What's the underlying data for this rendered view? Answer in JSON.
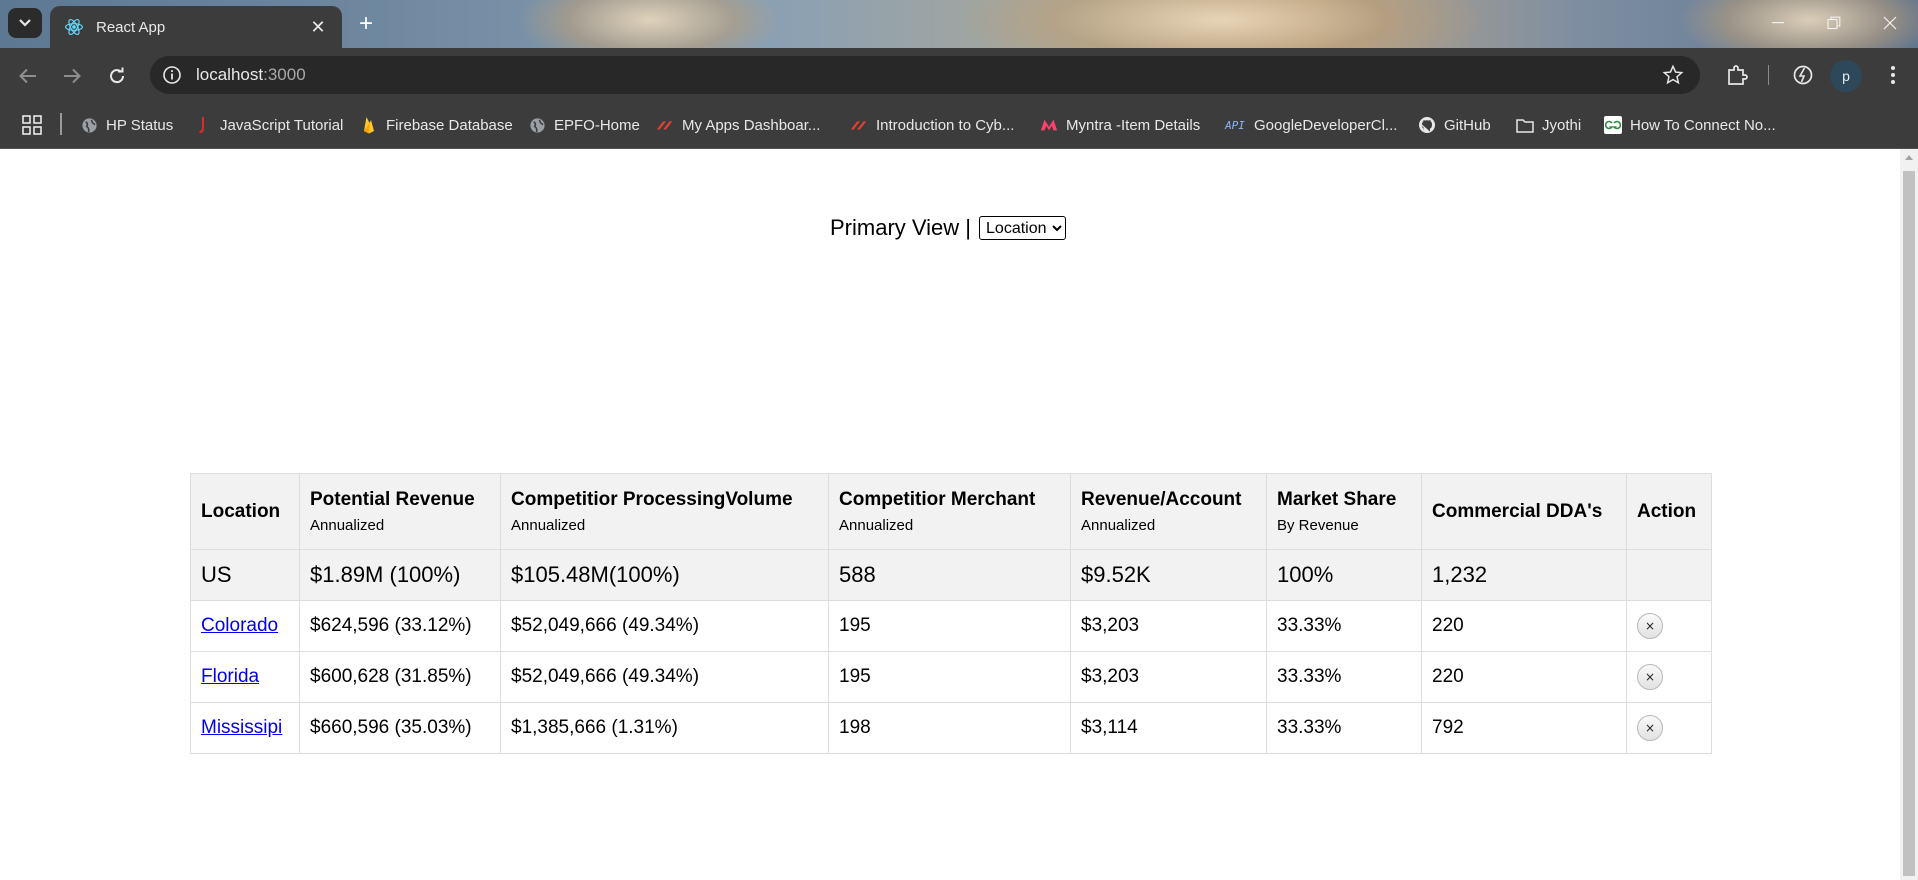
{
  "browser": {
    "tab_title": "React App",
    "url_host": "localhost",
    "url_port": ":3000",
    "profile_initial": "p",
    "bookmarks": [
      {
        "label": "HP Status",
        "icon": "globe-icon"
      },
      {
        "label": "JavaScript Tutorial",
        "icon": "javascript-tutorial-icon"
      },
      {
        "label": "Firebase Database",
        "icon": "firebase-icon"
      },
      {
        "label": "EPFO-Home",
        "icon": "globe-icon"
      },
      {
        "label": "My Apps Dashboar...",
        "icon": "zscaler-icon"
      },
      {
        "label": "Introduction to Cyb...",
        "icon": "zscaler-icon"
      },
      {
        "label": "Myntra -Item Details",
        "icon": "myntra-icon"
      },
      {
        "label": "GoogleDeveloperCl...",
        "icon": "api-icon"
      },
      {
        "label": "GitHub",
        "icon": "github-icon"
      },
      {
        "label": "Jyothi",
        "icon": "folder-icon"
      },
      {
        "label": "How To Connect No...",
        "icon": "geeksforgeeks-icon"
      }
    ]
  },
  "page": {
    "primary_view_label": "Primary View |",
    "primary_view_selected": "Location",
    "table": {
      "headers": [
        {
          "main": "Location",
          "sub": ""
        },
        {
          "main": "Potential Revenue",
          "sub": "Annualized"
        },
        {
          "main": "Competitior ProcessingVolume",
          "sub": "Annualized"
        },
        {
          "main": "Competitior Merchant",
          "sub": "Annualized"
        },
        {
          "main": "Revenue/Account",
          "sub": "Annualized"
        },
        {
          "main": "Market Share",
          "sub": "By Revenue"
        },
        {
          "main": "Commercial DDA's",
          "sub": ""
        },
        {
          "main": "Action",
          "sub": ""
        }
      ],
      "total": {
        "location": "US",
        "potential_revenue": "$1.89M (100%)",
        "processing_volume": "$105.48M(100%)",
        "merchant": "588",
        "revenue_per_account": "$9.52K",
        "market_share": "100%",
        "commercial_dda": "1,232"
      },
      "rows": [
        {
          "location": "Colorado",
          "potential_revenue": "$624,596 (33.12%)",
          "processing_volume": "$52,049,666 (49.34%)",
          "merchant": "195",
          "revenue_per_account": "$3,203",
          "market_share": "33.33%",
          "commercial_dda": "220",
          "action": "×"
        },
        {
          "location": "Florida",
          "potential_revenue": "$600,628 (31.85%)",
          "processing_volume": "$52,049,666 (49.34%)",
          "merchant": "195",
          "revenue_per_account": "$3,203",
          "market_share": "33.33%",
          "commercial_dda": "220",
          "action": "×"
        },
        {
          "location": "Mississipi",
          "potential_revenue": "$660,596 (35.03%)",
          "processing_volume": "$1,385,666 (1.31%)",
          "merchant": "198",
          "revenue_per_account": "$3,114",
          "market_share": "33.33%",
          "commercial_dda": "792",
          "action": "×"
        }
      ]
    }
  }
}
